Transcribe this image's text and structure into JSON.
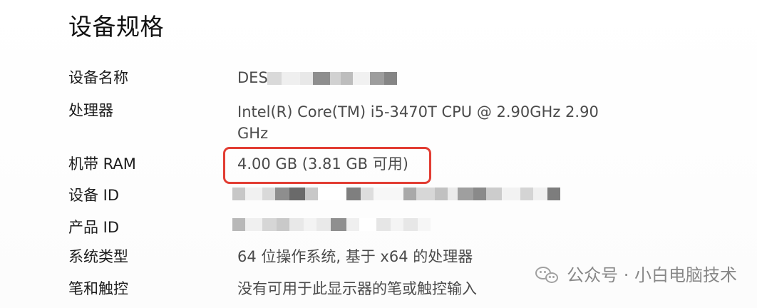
{
  "page": {
    "title": "设备规格"
  },
  "specs": {
    "device_name": {
      "label": "设备名称",
      "value_prefix": "DES"
    },
    "processor": {
      "label": "处理器",
      "value_line1": "Intel(R) Core(TM) i5-3470T CPU @ 2.90GHz   2.90",
      "value_line2": "GHz"
    },
    "ram": {
      "label": "机带 RAM",
      "value": "4.00 GB (3.81 GB 可用)"
    },
    "device_id": {
      "label": "设备 ID"
    },
    "product_id": {
      "label": "产品 ID"
    },
    "system_type": {
      "label": "系统类型",
      "value": "64 位操作系统, 基于 x64 的处理器"
    },
    "pen_touch": {
      "label": "笔和触控",
      "value": "没有可用于此显示器的笔或触控输入"
    }
  },
  "watermark": {
    "icon": "wechat-icon",
    "text": "公众号 · 小白电脑技术"
  },
  "colors": {
    "highlight": "#e23d33",
    "text_primary": "#1c1c1c",
    "text_secondary": "#4b4b4b"
  }
}
